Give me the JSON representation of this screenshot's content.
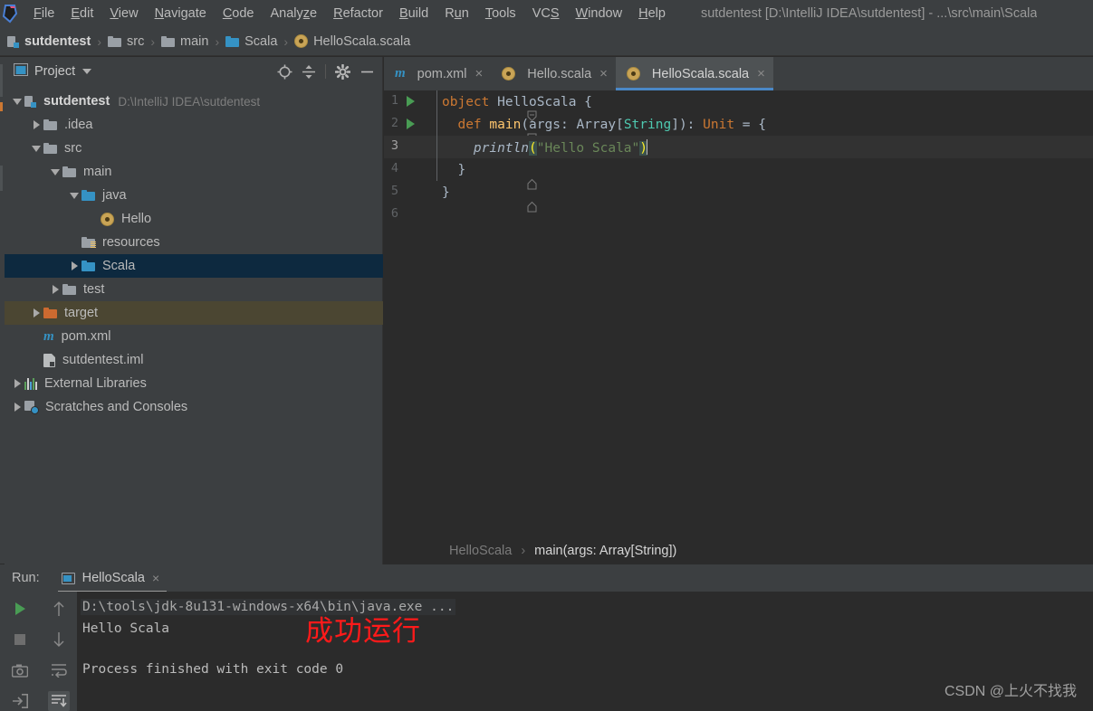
{
  "window": {
    "title": "sutdentest [D:\\IntelliJ IDEA\\sutdentest] - ...\\src\\main\\Scala",
    "app_icon": "intellij-idea-logo"
  },
  "menubar": {
    "items": [
      {
        "label": "File",
        "mnemonic": "F"
      },
      {
        "label": "Edit",
        "mnemonic": "E"
      },
      {
        "label": "View",
        "mnemonic": "V"
      },
      {
        "label": "Navigate",
        "mnemonic": "N"
      },
      {
        "label": "Code",
        "mnemonic": "C"
      },
      {
        "label": "Analyze",
        "mnemonic": "z"
      },
      {
        "label": "Refactor",
        "mnemonic": "R"
      },
      {
        "label": "Build",
        "mnemonic": "B"
      },
      {
        "label": "Run",
        "mnemonic": "u"
      },
      {
        "label": "Tools",
        "mnemonic": "T"
      },
      {
        "label": "VCS",
        "mnemonic": "S"
      },
      {
        "label": "Window",
        "mnemonic": "W"
      },
      {
        "label": "Help",
        "mnemonic": "H"
      }
    ]
  },
  "navbar": {
    "crumbs": [
      {
        "label": "sutdentest",
        "icon": "module-icon",
        "bold": true
      },
      {
        "label": "src",
        "icon": "folder-grey",
        "bold": false
      },
      {
        "label": "main",
        "icon": "folder-grey",
        "bold": false
      },
      {
        "label": "Scala",
        "icon": "folder-blue",
        "bold": false
      },
      {
        "label": "HelloScala.scala",
        "icon": "scala-object-icon",
        "bold": false
      }
    ],
    "separator": "›"
  },
  "project_panel": {
    "title": "Project",
    "tools": [
      {
        "name": "locate-icon"
      },
      {
        "name": "collapse-all-icon"
      },
      {
        "name": "settings-gear-icon"
      },
      {
        "name": "hide-icon"
      }
    ],
    "tree": [
      {
        "label": "sutdentest",
        "path": "D:\\IntelliJ IDEA\\sutdentest",
        "indent": 0,
        "arrow": "down",
        "icon": "module-icon",
        "bold": true,
        "state": ""
      },
      {
        "label": ".idea",
        "path": "",
        "indent": 1,
        "arrow": "right",
        "icon": "folder-grey",
        "bold": false,
        "state": ""
      },
      {
        "label": "src",
        "path": "",
        "indent": 1,
        "arrow": "down",
        "icon": "folder-grey",
        "bold": false,
        "state": ""
      },
      {
        "label": "main",
        "path": "",
        "indent": 2,
        "arrow": "down",
        "icon": "folder-grey",
        "bold": false,
        "state": ""
      },
      {
        "label": "java",
        "path": "",
        "indent": 3,
        "arrow": "down",
        "icon": "folder-blue",
        "bold": false,
        "state": ""
      },
      {
        "label": "Hello",
        "path": "",
        "indent": 4,
        "arrow": "none",
        "icon": "scala-object-icon",
        "bold": false,
        "state": ""
      },
      {
        "label": "resources",
        "path": "",
        "indent": 3,
        "arrow": "none",
        "icon": "folder-resources",
        "bold": false,
        "state": ""
      },
      {
        "label": "Scala",
        "path": "",
        "indent": 3,
        "arrow": "right",
        "icon": "folder-blue",
        "bold": false,
        "state": "selected"
      },
      {
        "label": "test",
        "path": "",
        "indent": 2,
        "arrow": "right",
        "icon": "folder-grey",
        "bold": false,
        "state": ""
      },
      {
        "label": "target",
        "path": "",
        "indent": 1,
        "arrow": "right",
        "icon": "folder-orange",
        "bold": false,
        "state": "highlighted"
      },
      {
        "label": "pom.xml",
        "path": "",
        "indent": 1,
        "arrow": "none",
        "icon": "maven-icon",
        "bold": false,
        "state": ""
      },
      {
        "label": "sutdentest.iml",
        "path": "",
        "indent": 1,
        "arrow": "none",
        "icon": "iml-icon",
        "bold": false,
        "state": ""
      },
      {
        "label": "External Libraries",
        "path": "",
        "indent": 0,
        "arrow": "right",
        "icon": "external-libraries-icon",
        "bold": false,
        "state": ""
      },
      {
        "label": "Scratches and Consoles",
        "path": "",
        "indent": 0,
        "arrow": "right",
        "icon": "scratches-icon",
        "bold": false,
        "state": ""
      }
    ]
  },
  "editor": {
    "tabs": [
      {
        "label": "pom.xml",
        "icon": "maven-icon",
        "active": false,
        "close": "×"
      },
      {
        "label": "Hello.scala",
        "icon": "scala-object-icon",
        "active": false,
        "close": "×"
      },
      {
        "label": "HelloScala.scala",
        "icon": "scala-object-icon",
        "active": true,
        "close": "×"
      }
    ],
    "lines": [
      {
        "num": "1",
        "run_marker": true,
        "fold": "open",
        "current": false
      },
      {
        "num": "2",
        "run_marker": true,
        "fold": "open",
        "current": false
      },
      {
        "num": "3",
        "run_marker": false,
        "fold": "none",
        "current": true
      },
      {
        "num": "4",
        "run_marker": false,
        "fold": "close",
        "current": false
      },
      {
        "num": "5",
        "run_marker": false,
        "fold": "close",
        "current": false
      },
      {
        "num": "6",
        "run_marker": false,
        "fold": "none",
        "current": false
      }
    ],
    "code_text": [
      "object HelloScala {",
      "  def main(args: Array[String]): Unit = {",
      "    println(\"Hello Scala\")",
      "  }",
      "}",
      ""
    ],
    "breadcrumb": {
      "parent": "HelloScala",
      "separator": "›",
      "current": "main(args: Array[String])"
    },
    "colors": {
      "keyword": "#cc7832",
      "method": "#ffc66d",
      "type": "#4ec9b0",
      "string": "#6a8759",
      "identifier": "#a9b7c6",
      "background": "#2b2b2b",
      "current_line": "#323232",
      "tab_underline": "#4a88c7"
    }
  },
  "run_panel": {
    "label": "Run:",
    "tab": {
      "label": "HelloScala",
      "icon": "run-config-icon",
      "close": "×"
    },
    "toolbar_left": [
      {
        "name": "rerun-icon",
        "active": false
      },
      {
        "name": "stop-icon",
        "active": false
      },
      {
        "name": "screenshot-icon",
        "active": false
      },
      {
        "name": "export-icon",
        "active": false
      }
    ],
    "toolbar_right": [
      {
        "name": "up-arrow-icon",
        "active": false
      },
      {
        "name": "down-arrow-icon",
        "active": false
      },
      {
        "name": "soft-wrap-icon",
        "active": false
      },
      {
        "name": "scroll-to-end-icon",
        "active": true
      }
    ],
    "console": {
      "command": "D:\\tools\\jdk-8u131-windows-x64\\bin\\java.exe ...",
      "output": "Hello Scala",
      "exit": "Process finished with exit code 0"
    },
    "annotation": {
      "text": "成功运行",
      "color": "#ff1a1a"
    }
  },
  "watermark": {
    "text": "CSDN @上火不找我"
  }
}
